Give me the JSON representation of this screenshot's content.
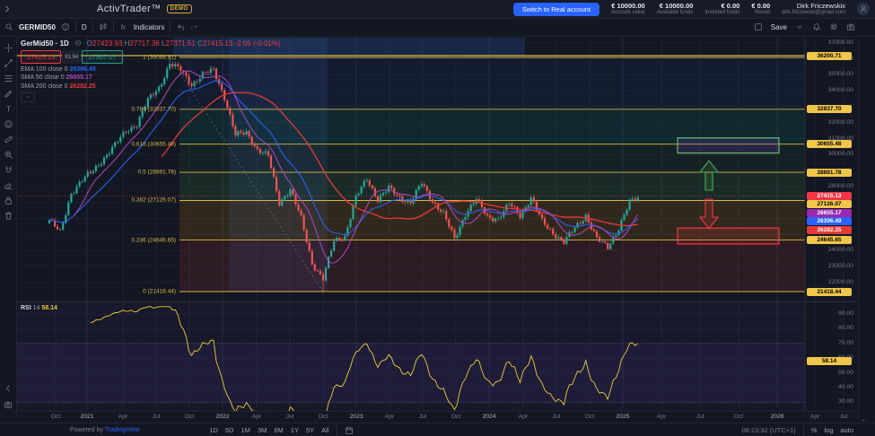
{
  "topbar": {
    "logo": "ActivTrader™",
    "demo_badge": "DEMO",
    "switch_button": "Switch to Real account",
    "stats": [
      {
        "value": "€ 10000.00",
        "label": "Account value"
      },
      {
        "value": "€ 10000.00",
        "label": "Available funds"
      },
      {
        "value": "€ 0.00",
        "label": "Invested funds"
      },
      {
        "value": "€ 0.00",
        "label": "Result"
      }
    ],
    "user": {
      "name": "Dirk Friczewskix",
      "email": "dirk.friczewski@gmail.com"
    }
  },
  "symbol_toolbar": {
    "symbol": "GERMID50",
    "timeframe": "D",
    "indicators_label": "Indicators"
  },
  "chart_toolbar": {
    "save_label": "Save"
  },
  "tools": [
    "crosshair",
    "trend-line",
    "fib-retracement",
    "brush",
    "text-tool",
    "emoji",
    "measure",
    "zoom",
    "magnet",
    "eraser",
    "lock",
    "trash"
  ],
  "legend": {
    "title": "GerMid50 · 1D",
    "ohlc": [
      {
        "label": "O",
        "value": "27423.93"
      },
      {
        "label": "H",
        "value": "27717.36"
      },
      {
        "label": "L",
        "value": "27371.51"
      },
      {
        "label": "C",
        "value": "27415.13"
      }
    ],
    "change": "-2.05 (-0.01%)",
    "sell": "27415.13",
    "spread": "91.94",
    "buy": "27507.07",
    "indicators": [
      {
        "label": "EMA 100 close 0",
        "value": "26396.49",
        "color": "#2962ff"
      },
      {
        "label": "SMA 50 close 0",
        "value": "26655.17",
        "color": "#ab47bc"
      },
      {
        "label": "SMA 200 close 0",
        "value": "26282.25",
        "color": "#e53935"
      }
    ]
  },
  "fib_levels": [
    {
      "label": "1",
      "value": "36088.91",
      "price": 36088.91
    },
    {
      "label": "0.786",
      "value": "32837.70",
      "price": 32837.7
    },
    {
      "label": "0.618",
      "value": "30655.48",
      "price": 30655.48
    },
    {
      "label": "0.5",
      "value": "28891.78",
      "price": 28891.78
    },
    {
      "label": "0.382",
      "value": "27126.07",
      "price": 27126.07
    },
    {
      "label": "0.236",
      "value": "24645.65",
      "price": 24645.65
    },
    {
      "label": "0",
      "value": "21418.44",
      "price": 21418.44
    }
  ],
  "price_axis": {
    "ticks": [
      "37000.00",
      "36000.00",
      "35000.00",
      "34000.00",
      "32000.00",
      "31000.00",
      "30000.00",
      "28000.00",
      "24000.00",
      "23000.00",
      "22000.00"
    ],
    "badges": [
      {
        "text": "36200.71",
        "price": 36200.71,
        "bg": "#f0c64b",
        "fg": "#000000"
      },
      {
        "text": "32837.70",
        "price": 32837.7,
        "bg": "#f0c64b",
        "fg": "#000000"
      },
      {
        "text": "30655.48",
        "price": 30655.48,
        "bg": "#f0c64b",
        "fg": "#000000"
      },
      {
        "text": "28891.78",
        "price": 28891.78,
        "bg": "#f0c64b",
        "fg": "#000000"
      },
      {
        "text": "27415.13",
        "price": 27415.13,
        "bg": "#f23645",
        "fg": "#ffffff"
      },
      {
        "text": "27126.07",
        "price": 27126.07,
        "bg": "#f0c64b",
        "fg": "#000000"
      },
      {
        "text": "26655.17",
        "price": 26655.17,
        "bg": "#9c27b0",
        "fg": "#ffffff"
      },
      {
        "text": "26396.49",
        "price": 26396.49,
        "bg": "#2962ff",
        "fg": "#ffffff"
      },
      {
        "text": "26282.25",
        "price": 26282.25,
        "bg": "#e53935",
        "fg": "#ffffff"
      }
    ],
    "lower_badges": [
      {
        "text": "24645.65",
        "price": 24645.65,
        "bg": "#f0c64b",
        "fg": "#000000"
      },
      {
        "text": "21418.44",
        "price": 21418.44,
        "bg": "#f0c64b",
        "fg": "#000000"
      }
    ]
  },
  "rsi": {
    "label": "RSI",
    "period": "14",
    "value": "58.14",
    "ticks": [
      "90.00",
      "80.00",
      "70.00",
      "60.00",
      "50.00",
      "40.00",
      "30.00"
    ]
  },
  "timeline": {
    "labels": [
      "Oct",
      "2021",
      "Apr",
      "Jul",
      "Oct",
      "2022",
      "Apr",
      "Jul",
      "Oct",
      "2023",
      "Apr",
      "Jul",
      "Oct",
      "2024",
      "Apr",
      "Jul",
      "Oct",
      "2025",
      "Apr",
      "Jul",
      "Oct",
      "2026",
      "Apr",
      "Jul"
    ]
  },
  "bottombar": {
    "powered_by": "Powered by",
    "tradingview": "TradingView",
    "ranges": [
      "1D",
      "5D",
      "1M",
      "3M",
      "6M",
      "1Y",
      "5Y",
      "All"
    ],
    "clock": "08:23:32 (UTC+1)",
    "scale_modes": [
      "%",
      "log",
      "auto"
    ]
  },
  "chart_data": {
    "type": "candlestick",
    "title": "GerMid50 1D",
    "high_wick": 36088.91,
    "low_wick": 21418.44,
    "hline": 36200.71,
    "months": [
      "2020-09",
      "2020-10",
      "2020-11",
      "2020-12",
      "2021-01",
      "2021-02",
      "2021-03",
      "2021-04",
      "2021-05",
      "2021-06",
      "2021-07",
      "2021-08",
      "2021-09",
      "2021-10",
      "2021-11",
      "2021-12",
      "2022-01",
      "2022-02",
      "2022-03",
      "2022-04",
      "2022-05",
      "2022-06",
      "2022-07",
      "2022-08",
      "2022-09",
      "2022-10",
      "2022-11",
      "2022-12",
      "2023-01",
      "2023-02",
      "2023-03",
      "2023-04",
      "2023-05",
      "2023-06",
      "2023-07",
      "2023-08",
      "2023-09",
      "2023-10",
      "2023-11",
      "2023-12",
      "2024-01",
      "2024-02",
      "2024-03",
      "2024-04",
      "2024-05",
      "2024-06",
      "2024-07",
      "2024-08",
      "2024-09",
      "2024-10",
      "2024-11",
      "2024-12",
      "2025-01",
      "2025-02",
      "2025-03"
    ],
    "monthly_closes": [
      25900,
      25100,
      27600,
      28400,
      29000,
      29800,
      30600,
      31500,
      31900,
      33400,
      34200,
      35700,
      35300,
      34400,
      35000,
      35300,
      33600,
      31200,
      31400,
      30300,
      29900,
      27000,
      27800,
      26000,
      23200,
      22200,
      24600,
      24900,
      27300,
      28500,
      27200,
      27900,
      27300,
      27000,
      28200,
      27100,
      26300,
      24700,
      26300,
      27200,
      26100,
      26000,
      26900,
      26200,
      27300,
      25800,
      25100,
      24500,
      25400,
      26200,
      24700,
      24200,
      25400,
      27000,
      27415
    ],
    "rsi_period": 14,
    "colors": {
      "candle_up": "#26a69a",
      "candle_down": "#ef5350",
      "ema100": "#2962ff",
      "sma50": "#ab47bc",
      "sma200": "#e53935",
      "fib_line": "#d8b64a",
      "rsi_line": "#f0cb37",
      "box_up_border": "#66bb6a",
      "box_down_border": "#f23645",
      "arrow_up": "#4caf50",
      "arrow_down": "#f23645"
    }
  }
}
